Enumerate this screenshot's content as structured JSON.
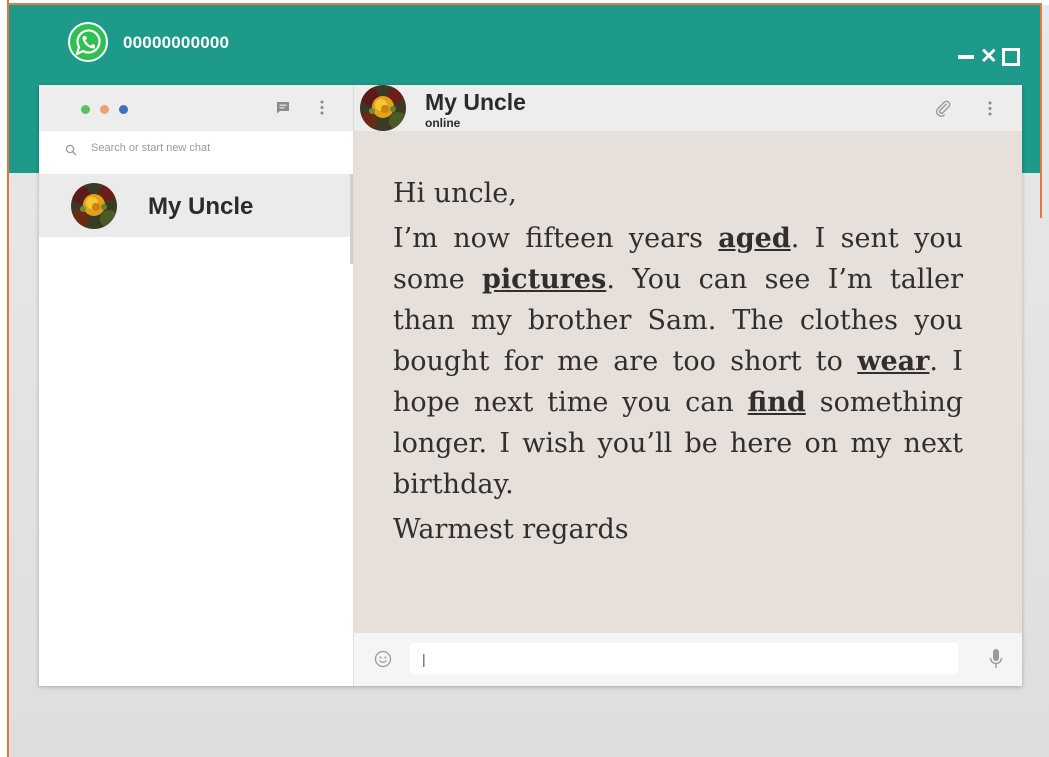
{
  "app": {
    "phone_number": "00000000000",
    "brand_color": "#1d9a8a",
    "logo_icon": "whatsapp-logo-icon",
    "window_controls": [
      "minimize-icon",
      "close-icon",
      "maximize-icon"
    ]
  },
  "sidebar": {
    "status_dots": [
      {
        "icon": "status-dot-green",
        "color": "#5cbf62"
      },
      {
        "icon": "status-dot-orange",
        "color": "#f0a070"
      },
      {
        "icon": "status-dot-blue",
        "color": "#3d70c4"
      }
    ],
    "header_icons": [
      "new-chat-icon",
      "menu-icon"
    ],
    "search": {
      "icon": "search-icon",
      "placeholder": "Search or start new chat"
    },
    "chats": [
      {
        "name": "My Uncle",
        "avatar": "flower-avatar"
      }
    ]
  },
  "conversation": {
    "contact_name": "My Uncle",
    "status": "online",
    "header_icons": [
      "attach-icon",
      "menu-icon"
    ],
    "message": {
      "greeting": "Hi uncle,",
      "parts": [
        {
          "text": "I’m now fifteen years ",
          "emphasis": false
        },
        {
          "text": "aged",
          "emphasis": true
        },
        {
          "text": ". I sent you some ",
          "emphasis": false
        },
        {
          "text": "pictures",
          "emphasis": true
        },
        {
          "text": ". You can see I’m taller than my brother Sam. The clothes you bought for me are too short to ",
          "emphasis": false
        },
        {
          "text": "wear",
          "emphasis": true
        },
        {
          "text": ". I hope next time you can ",
          "emphasis": false
        },
        {
          "text": "find",
          "emphasis": true
        },
        {
          "text": " something longer. I wish you’ll be here on my next birthday.",
          "emphasis": false
        }
      ],
      "closing": "Warmest regards"
    },
    "compose": {
      "value": "|",
      "emoji_icon": "emoji-icon",
      "mic_icon": "microphone-icon"
    },
    "chat_background": "#e7dfd9"
  }
}
